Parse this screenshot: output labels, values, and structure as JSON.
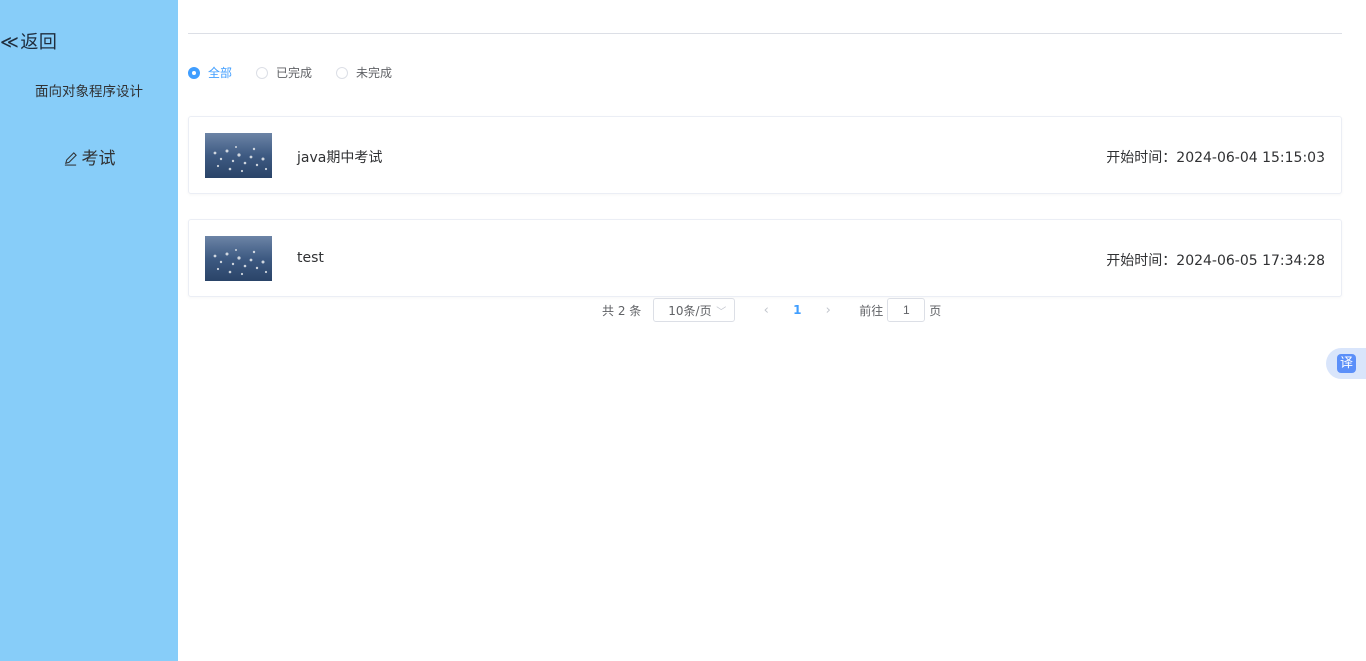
{
  "sidebar": {
    "back_label": "返回",
    "course_name": "面向对象程序设计",
    "nav_exam_label": "考试"
  },
  "filters": {
    "options": [
      "全部",
      "已完成",
      "未完成"
    ],
    "selected": "全部"
  },
  "exams": [
    {
      "title": "java期中考试",
      "start_label": "开始时间：",
      "start_time": "2024-06-04 15:15:03"
    },
    {
      "title": "test",
      "start_label": "开始时间：",
      "start_time": "2024-06-05 17:34:28"
    }
  ],
  "pagination": {
    "total_text": "共 2 条",
    "page_size": "10条/页",
    "current_page": "1",
    "goto_prefix": "前往",
    "goto_value": "1",
    "goto_suffix": "页"
  },
  "translate_button": {
    "label": "译"
  },
  "colors": {
    "sidebar": "#87cdf9",
    "accent": "#409eff"
  },
  "icons": {
    "back": "double-chevron-left-icon",
    "exam": "pencil-icon",
    "prev": "chevron-left-icon",
    "next": "chevron-right-icon",
    "dropdown": "chevron-down-icon"
  }
}
